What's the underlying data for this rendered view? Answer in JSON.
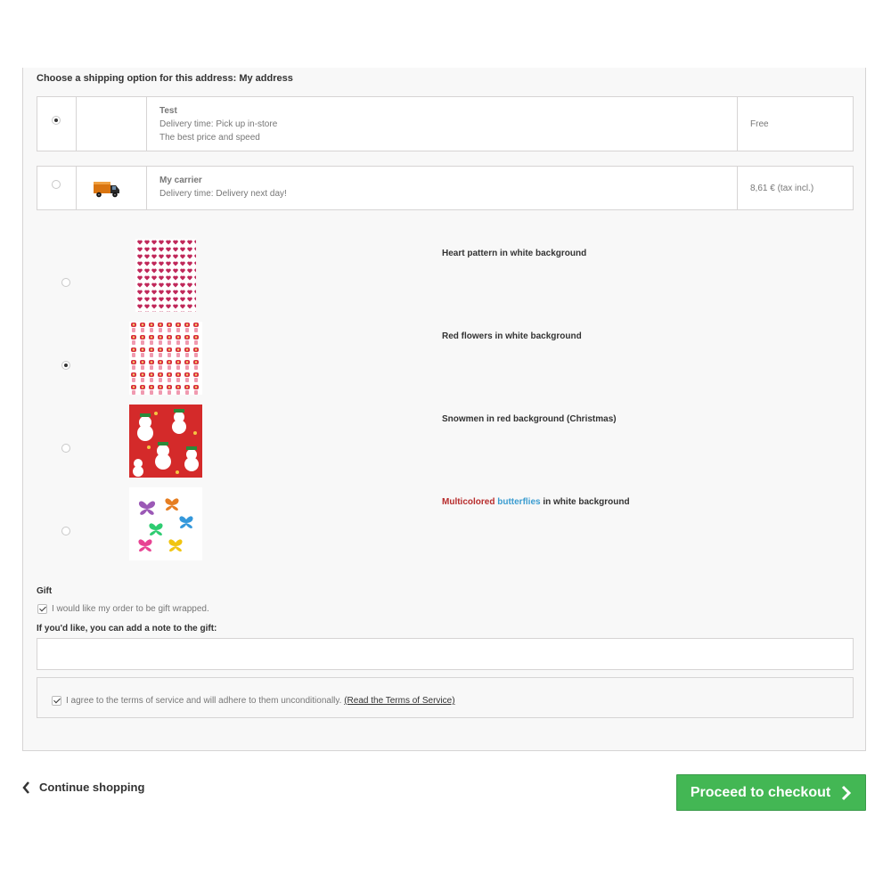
{
  "shipping": {
    "heading": "Choose a shipping option for this address: My address",
    "carriers": [
      {
        "name": "Test",
        "line1": "Delivery time: Pick up in-store",
        "line2": "The best price and speed",
        "price": "Free",
        "selected": true
      },
      {
        "name": "My carrier",
        "line1": "Delivery time: Delivery next day!",
        "price": "8,61 € (tax incl.)",
        "selected": false,
        "logo": "truck-icon"
      }
    ]
  },
  "wrapping": {
    "options": [
      {
        "label": "Heart pattern in white background",
        "selected": false,
        "pattern": "hearts"
      },
      {
        "label": "Red flowers in white background",
        "selected": true,
        "pattern": "flowers"
      },
      {
        "label": "Snowmen in red background (Christmas)",
        "selected": false,
        "pattern": "snowmen"
      },
      {
        "label_part1": "Multicolored",
        "label_part2": "butterflies",
        "label_part3": "in white background",
        "selected": false,
        "pattern": "butterflies"
      }
    ]
  },
  "gift": {
    "title": "Gift",
    "checkbox_label": "I would like my order to be gift wrapped.",
    "checked": true,
    "note_label": "If you'd like, you can add a note to the gift:",
    "note_value": ""
  },
  "terms": {
    "text": "I agree to the terms of service and will adhere to them unconditionally.",
    "link": "(Read the Terms of Service)",
    "checked": true
  },
  "footer": {
    "continue_label": "Continue shopping",
    "checkout_label": "Proceed to checkout"
  },
  "colors": {
    "checkout_green": "#43b754",
    "red_text": "#b72c2c",
    "blue_text": "#3a9cd0"
  }
}
